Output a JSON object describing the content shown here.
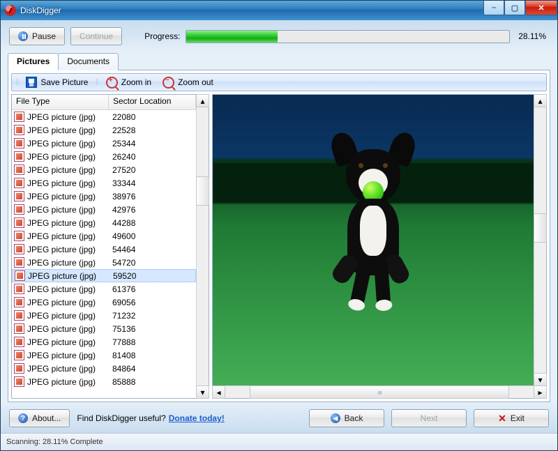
{
  "window": {
    "title": "DiskDigger",
    "controls": {
      "minimize": "–",
      "maximize": "▢",
      "close": "✕"
    }
  },
  "controls_row": {
    "pause_label": "Pause",
    "continue_label": "Continue",
    "progress_label": "Progress:",
    "progress_percent": 28.11,
    "progress_percent_text": "28.11%"
  },
  "tabs": {
    "pictures": "Pictures",
    "documents": "Documents",
    "active": "pictures"
  },
  "toolbar": {
    "save_picture": "Save Picture",
    "zoom_in": "Zoom in",
    "zoom_out": "Zoom out"
  },
  "list": {
    "columns": {
      "file_type": "File Type",
      "sector": "Sector Location"
    },
    "file_type_label": "JPEG picture (jpg)",
    "selected_index": 12,
    "rows": [
      {
        "sector": "22080"
      },
      {
        "sector": "22528"
      },
      {
        "sector": "25344"
      },
      {
        "sector": "26240"
      },
      {
        "sector": "27520"
      },
      {
        "sector": "33344"
      },
      {
        "sector": "38976"
      },
      {
        "sector": "42976"
      },
      {
        "sector": "44288"
      },
      {
        "sector": "49600"
      },
      {
        "sector": "54464"
      },
      {
        "sector": "54720"
      },
      {
        "sector": "59520"
      },
      {
        "sector": "61376"
      },
      {
        "sector": "69056"
      },
      {
        "sector": "71232"
      },
      {
        "sector": "75136"
      },
      {
        "sector": "77888"
      },
      {
        "sector": "81408"
      },
      {
        "sector": "84864"
      },
      {
        "sector": "85888"
      }
    ]
  },
  "footer": {
    "about": "About...",
    "useful_text": "Find DiskDigger useful?",
    "donate": "Donate today!",
    "back": "Back",
    "next": "Next",
    "exit": "Exit"
  },
  "status": {
    "text": "Scanning: 28.11% Complete"
  },
  "preview": {
    "hscroll_label": "ıııı"
  }
}
